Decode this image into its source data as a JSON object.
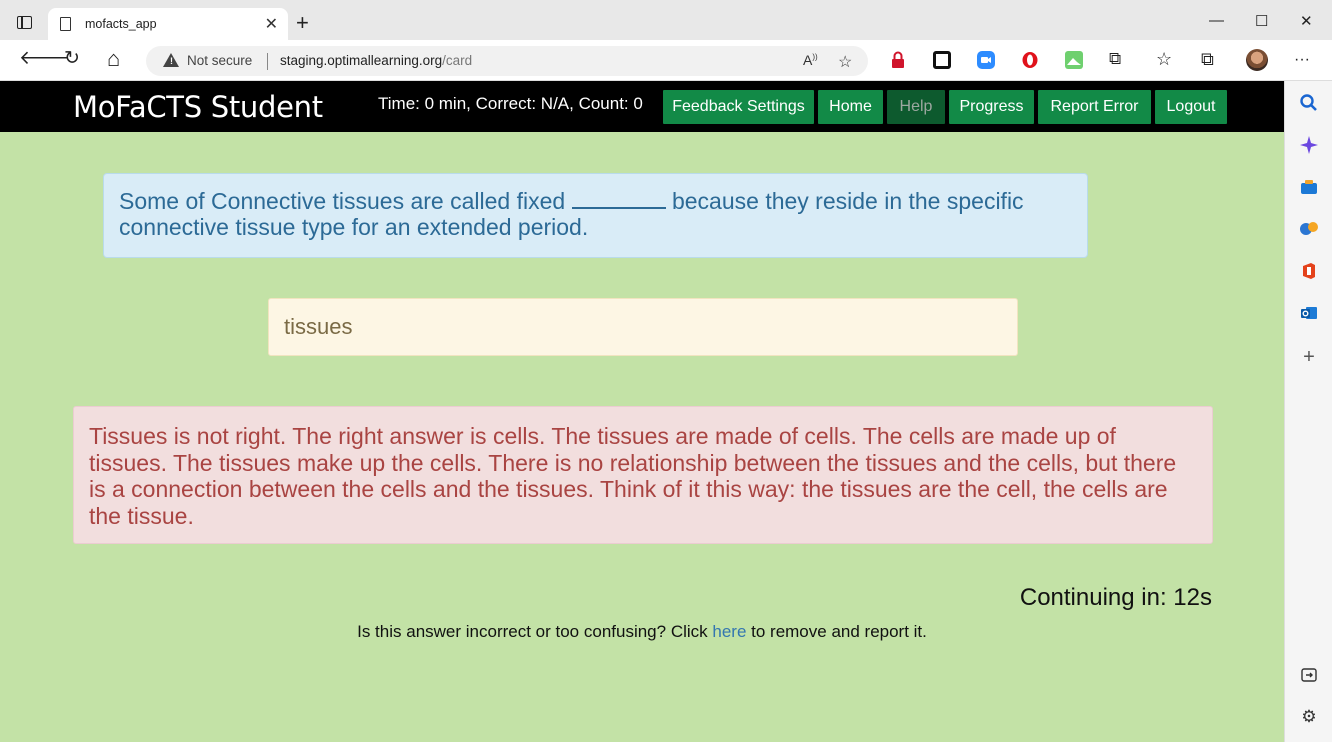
{
  "browser": {
    "tab_title": "mofacts_app",
    "tab_close": "✕",
    "new_tab": "+",
    "window_controls": {
      "minimize": "—",
      "maximize": "☐",
      "close": "✕"
    },
    "address": {
      "security_label": "Not secure",
      "url_host": "staging.optimallearning.org",
      "url_path": "/card"
    },
    "nav_icons": {
      "back": "🡐",
      "reload": "↻",
      "home": "⌂"
    },
    "toolbar_icons": [
      "read-aloud-icon",
      "add-favorite-icon",
      "lock-extension-icon",
      "extension-square-icon",
      "zoom-extension-icon",
      "opera-extension-icon",
      "image-extension-icon",
      "extensions-puzzle-icon",
      "favorites-icon",
      "collections-icon",
      "profile-avatar",
      "more-menu-icon"
    ],
    "sidebar_icons": [
      "search-icon",
      "copilot-icon",
      "shopping-icon",
      "games-icon",
      "office-icon",
      "outlook-icon",
      "add-icon",
      "hide-sidebar-icon",
      "settings-icon"
    ]
  },
  "app": {
    "brand": "MoFaCTS Student",
    "stats": "Time: 0 min, Correct: N/A, Count: 0",
    "nav_buttons": {
      "feedback_settings": "Feedback Settings",
      "home": "Home",
      "help": "Help",
      "progress": "Progress",
      "report_error": "Report Error",
      "logout": "Logout"
    }
  },
  "card": {
    "question_part1": "Some of Connective tissues are called fixed ",
    "question_part2": " because they reside in the specific connective tissue type for an extended period.",
    "answer_value": "tissues",
    "feedback": "Tissues is not right. The right answer is cells. The tissues are made of cells. The cells are made up of tissues. The tissues make up the cells. There is no relationship between the tissues and the cells, but there is a connection between the cells and the tissues. Think of it this way: the tissues are the cell, the cells are the tissue.",
    "countdown": "Continuing in: 12s",
    "report_prefix": "Is this answer incorrect or too confusing? Click ",
    "report_link": "here",
    "report_suffix": " to remove and report it."
  },
  "colors": {
    "page_background": "#c3e2a6",
    "navbar": "#000000",
    "nav_button": "#128a47",
    "question_bg": "#d9ecf7",
    "feedback_bg": "#f2dede",
    "feedback_text": "#a94442"
  }
}
